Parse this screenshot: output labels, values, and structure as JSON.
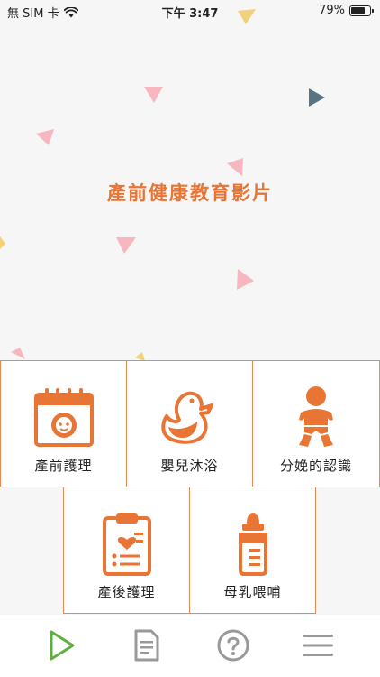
{
  "status_bar": {
    "carrier": "無 SIM 卡",
    "time": "下午 3:47",
    "battery_percent": "79%",
    "battery_level": 0.79
  },
  "hero": {
    "title": "產前健康教育影片"
  },
  "tiles": [
    {
      "label": "產前護理",
      "icon": "calendar-baby-icon"
    },
    {
      "label": "嬰兒沐浴",
      "icon": "rubber-duck-icon"
    },
    {
      "label": "分娩的認識",
      "icon": "baby-icon"
    },
    {
      "label": "產後護理",
      "icon": "clipboard-heart-icon"
    },
    {
      "label": "母乳喂哺",
      "icon": "baby-bottle-icon"
    }
  ],
  "tabbar": {
    "items": [
      {
        "icon": "play-icon",
        "active": true
      },
      {
        "icon": "document-icon",
        "active": false
      },
      {
        "icon": "help-icon",
        "active": false
      },
      {
        "icon": "menu-icon",
        "active": false
      }
    ]
  },
  "colors": {
    "accent": "#e97535",
    "tab_active": "#5fae3e",
    "tab_inactive": "#999999"
  }
}
